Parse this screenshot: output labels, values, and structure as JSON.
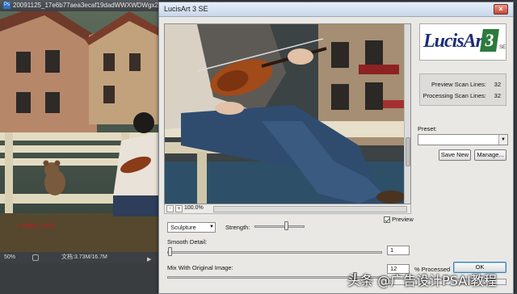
{
  "document_window": {
    "title": "20091125_17e6b77aea3ecaf19dadWWXWDWgx2",
    "zoom": "50%",
    "doc_info": "文档:3.73M/16.7M",
    "ps_icon": "Ps"
  },
  "dialog": {
    "title": "LucisArt 3 SE",
    "close_label": "×",
    "logo": {
      "text": "LucisArt",
      "number": "3",
      "edition": "SE"
    },
    "scan_lines": {
      "preview_label": "Preview Scan Lines:",
      "preview_value": "32",
      "processing_label": "Processing Scan Lines:",
      "processing_value": "32"
    },
    "preset": {
      "label": "Preset:",
      "value": ""
    },
    "buttons": {
      "save_new": "Save New",
      "manage": "Manage...",
      "ok": "OK"
    },
    "preview_toolbar": {
      "zoom_out": "-",
      "zoom_value": "100.0%",
      "zoom_in": "+"
    },
    "preview_check_label": "Preview",
    "preview_checked": true,
    "mode": "Sculpture",
    "strength_label": "Strength:",
    "strength_level": 0.6,
    "smooth_label": "Smooth Detail:",
    "smooth_value": "1",
    "mix_label": "Mix With Original Image:",
    "mix_value": "12",
    "processed_label": "% Processed",
    "processed_fraction": 0.0
  },
  "watermark": "头条 @广告设计PSAI教程",
  "colors": {
    "accent": "#1c2e78",
    "logo_green": "#2c7a3c"
  }
}
